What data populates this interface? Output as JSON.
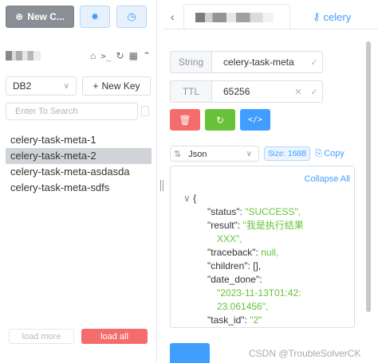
{
  "left": {
    "new_connection_label": "New C...",
    "db_select": "DB2",
    "new_key_label": "New Key",
    "search_placeholder": "Enter To Search",
    "keys": [
      "celery-task-meta-1",
      "celery-task-meta-2",
      "celery-task-meta-asdasda",
      "celery-task-meta-sdfs"
    ],
    "selected_key_index": 1,
    "load_more_label": "load more",
    "load_all_label": "load all"
  },
  "tabs": {
    "active_tab_label": "celery"
  },
  "detail": {
    "type_label": "String",
    "key_name": "celery-task-meta",
    "ttl_label": "TTL",
    "ttl_value": "65256",
    "format_select": "Json",
    "size_label": "Size: 168B",
    "copy_label": "Copy",
    "collapse_all_label": "Collapse All"
  },
  "json_view": {
    "status_key": "\"status\": ",
    "status_val": "\"SUCCESS\",",
    "result_key": "\"result\": ",
    "result_val_1": "\"我是执行结果",
    "result_val_2": "XXX\",",
    "traceback_key": "\"traceback\": ",
    "traceback_val": "null,",
    "children_key": "\"children\": [],",
    "date_done_key": "\"date_done\":",
    "date_done_val_1": "\"2023-11-13T01:42:",
    "date_done_val_2": "23.061456\",",
    "task_id_key": "\"task_id\": ",
    "task_id_val": "\"2\""
  },
  "watermark": "CSDN @TroubleSolverCK",
  "colors": {
    "primary": "#409eff",
    "danger": "#f56c6c",
    "success": "#67c23a",
    "selected_row": "#d0d3d8"
  }
}
